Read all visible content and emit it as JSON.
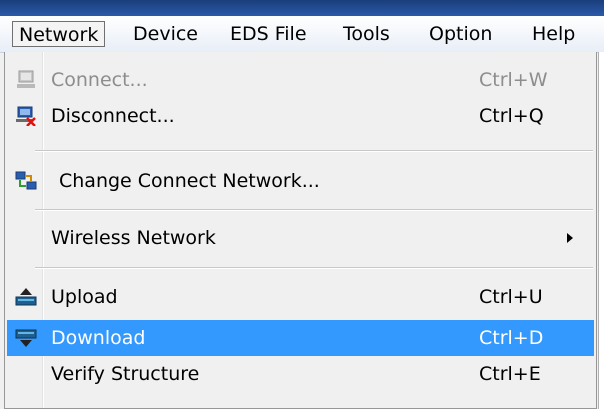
{
  "menubar": {
    "items": [
      {
        "label": "Network",
        "open": true
      },
      {
        "label": "Device"
      },
      {
        "label": "EDS File"
      },
      {
        "label": "Tools"
      },
      {
        "label": "Option"
      },
      {
        "label": "Help"
      }
    ]
  },
  "network_menu": {
    "items": [
      {
        "label": "Connect...",
        "shortcut": "Ctrl+W",
        "icon": "connect-icon",
        "enabled": false
      },
      {
        "label": "Disconnect...",
        "shortcut": "Ctrl+Q",
        "icon": "disconnect-icon",
        "enabled": true
      },
      {
        "label": "Change Connect Network...",
        "shortcut": "",
        "icon": "change-network-icon",
        "enabled": true
      },
      {
        "label": "Wireless Network",
        "shortcut": "",
        "icon": "",
        "enabled": true,
        "submenu": true
      },
      {
        "label": "Upload",
        "shortcut": "Ctrl+U",
        "icon": "upload-icon",
        "enabled": true
      },
      {
        "label": "Download",
        "shortcut": "Ctrl+D",
        "icon": "download-icon",
        "enabled": true,
        "highlighted": true
      },
      {
        "label": "Verify Structure",
        "shortcut": "Ctrl+E",
        "icon": "",
        "enabled": true
      }
    ]
  },
  "colors": {
    "highlight": "#3399ff",
    "disabled_text": "#8d8d8d",
    "menu_background": "#f0f0f0"
  }
}
